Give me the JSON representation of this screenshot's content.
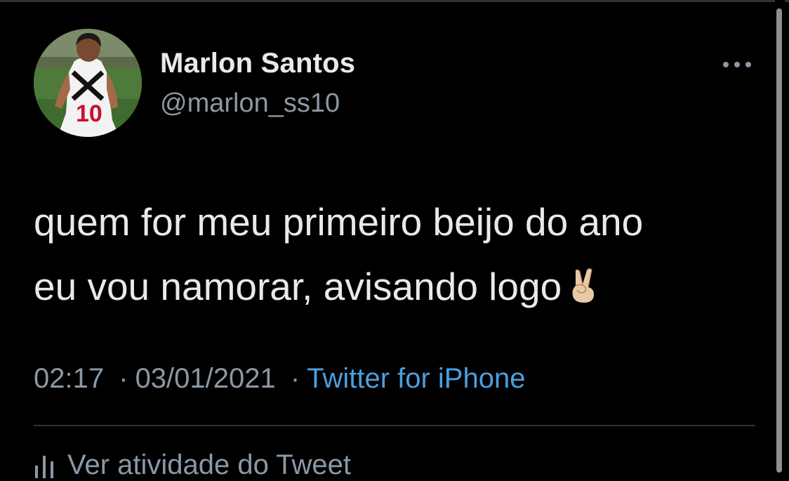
{
  "tweet": {
    "author": {
      "display_name": "Marlon Santos",
      "handle": "@marlon_ss10"
    },
    "text_line_1": "quem for meu primeiro beijo do ano",
    "text_line_2": "eu vou namorar, avisando logo",
    "emoji": "victory-hand-emoji",
    "time": "02:17",
    "date": "03/01/2021",
    "separator": "·",
    "source": "Twitter for iPhone",
    "activity_label": "Ver atividade do Tweet"
  },
  "icons": {
    "more": "more-horizontal-icon",
    "activity": "bar-chart-icon"
  },
  "colors": {
    "background": "#000000",
    "primary_text": "#e7e9ea",
    "secondary_text": "#8b98a5",
    "link": "#4a9fe0",
    "divider": "#2f3336"
  }
}
